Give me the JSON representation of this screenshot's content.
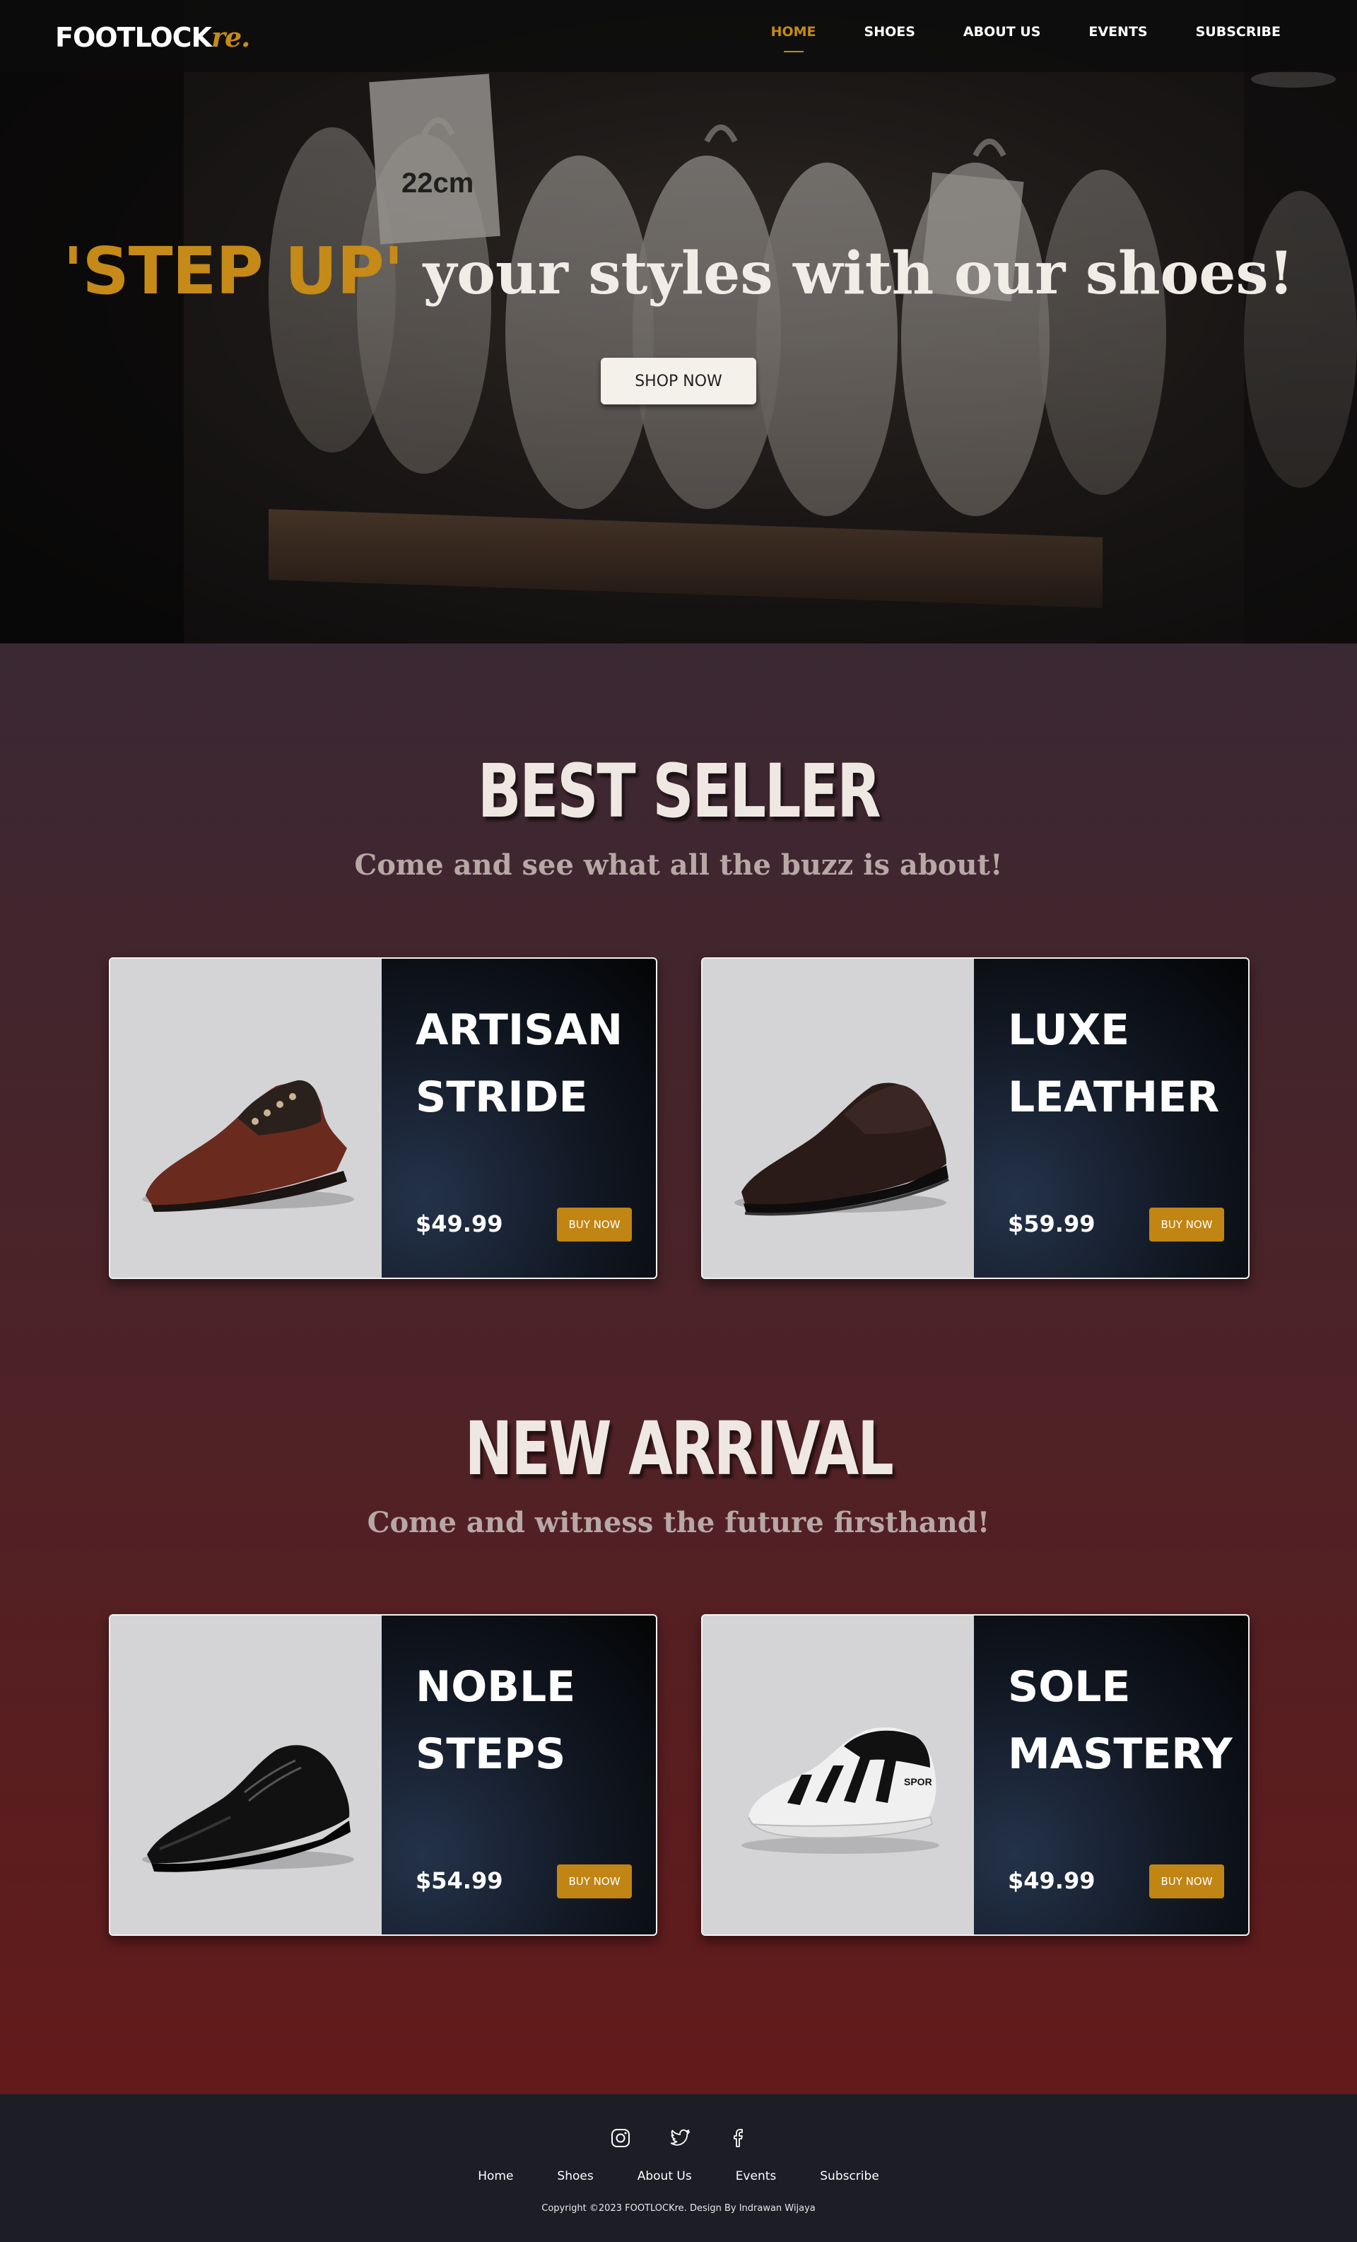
{
  "brand": {
    "name": "FOOTLOCK",
    "accent": "re.",
    "accent_color": "#c58a17"
  },
  "nav": {
    "items": [
      {
        "label": "HOME",
        "active": true
      },
      {
        "label": "SHOES",
        "active": false
      },
      {
        "label": "ABOUT US",
        "active": false
      },
      {
        "label": "EVENTS",
        "active": false
      },
      {
        "label": "SUBSCRIBE",
        "active": false
      }
    ]
  },
  "hero": {
    "highlight": "'STEP UP'",
    "title_rest": " your styles with our shoes!",
    "cta": "SHOP NOW",
    "tag_size": "22cm"
  },
  "best_seller": {
    "title": "BEST SELLER",
    "subtitle": "Come and see what all the buzz is about!",
    "products": [
      {
        "name": "ARTISAN STRIDE",
        "price": "$49.99",
        "button": "BUY NOW",
        "icon": "brown-oxford-shoe-icon"
      },
      {
        "name": "LUXE LEATHER",
        "price": "$59.99",
        "button": "BUY NOW",
        "icon": "dark-loafer-shoe-icon"
      }
    ]
  },
  "new_arrival": {
    "title": "NEW ARRIVAL",
    "subtitle": "Come and witness the future firsthand!",
    "products": [
      {
        "name": "NOBLE STEPS",
        "price": "$54.99",
        "button": "BUY NOW",
        "icon": "black-dress-shoe-icon"
      },
      {
        "name": "SOLE MASTERY",
        "price": "$49.99",
        "button": "BUY NOW",
        "icon": "sneaker-icon"
      }
    ]
  },
  "footer": {
    "socials": [
      "instagram-icon",
      "twitter-icon",
      "facebook-icon"
    ],
    "links": [
      "Home",
      "Shoes",
      "About Us",
      "Events",
      "Subscribe"
    ],
    "copyright": "Copyright ©2023 FOOTLOCKre. Design By Indrawan Wijaya"
  },
  "colors": {
    "accent": "#c58a17",
    "button": "#c18514",
    "footer_bg": "#1c1d25"
  }
}
